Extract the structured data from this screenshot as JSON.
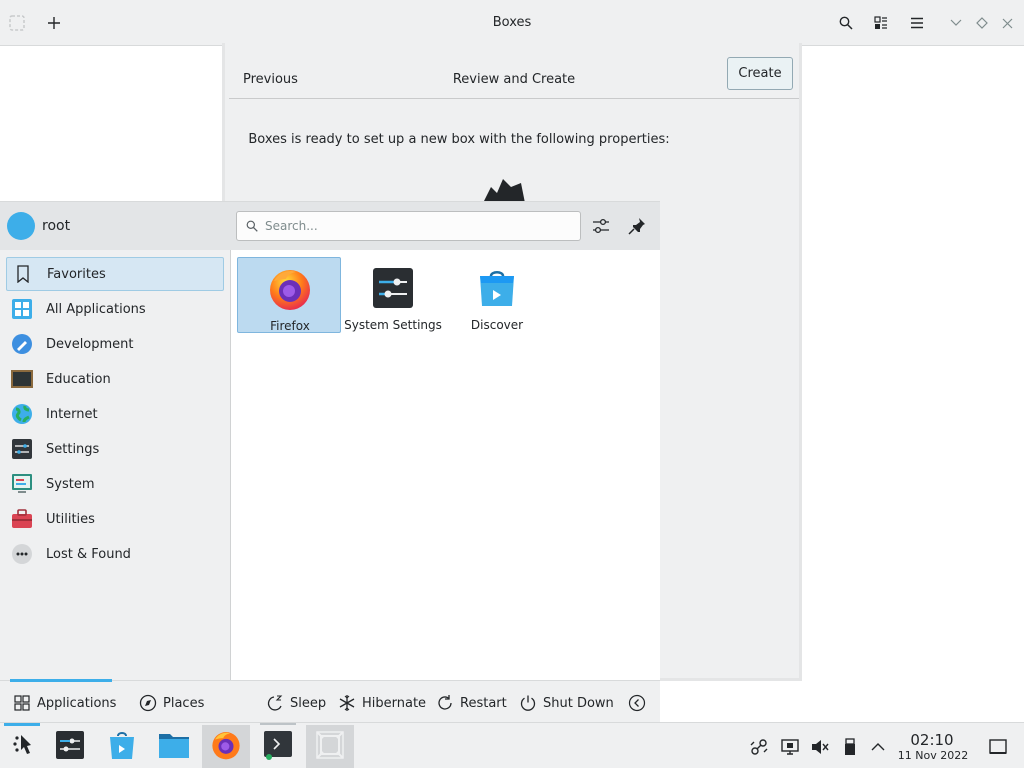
{
  "window": {
    "title": "Boxes"
  },
  "dialog": {
    "previous_label": "Previous",
    "title": "Review and Create",
    "create_label": "Create",
    "message": "Boxes is ready to set up a new box with the following properties:"
  },
  "launcher": {
    "username": "root",
    "search_placeholder": "Search...",
    "categories": [
      {
        "label": "Favorites",
        "icon": "bookmark-icon"
      },
      {
        "label": "All Applications",
        "icon": "grid-icon"
      },
      {
        "label": "Development",
        "icon": "development-icon"
      },
      {
        "label": "Education",
        "icon": "chalkboard-icon"
      },
      {
        "label": "Internet",
        "icon": "globe-icon"
      },
      {
        "label": "Settings",
        "icon": "settings-icon"
      },
      {
        "label": "System",
        "icon": "system-icon"
      },
      {
        "label": "Utilities",
        "icon": "toolbox-icon"
      },
      {
        "label": "Lost & Found",
        "icon": "more-icon"
      }
    ],
    "apps": [
      {
        "label": "Firefox",
        "icon": "firefox-icon"
      },
      {
        "label": "System Settings",
        "icon": "system-settings-icon"
      },
      {
        "label": "Discover",
        "icon": "discover-icon"
      }
    ],
    "footer": {
      "applications": "Applications",
      "places": "Places",
      "sleep": "Sleep",
      "hibernate": "Hibernate",
      "restart": "Restart",
      "shutdown": "Shut Down"
    }
  },
  "clock": {
    "time": "02:10",
    "date": "11 Nov 2022"
  },
  "colors": {
    "accent": "#3daee9",
    "selection": "#d6e7f3"
  }
}
